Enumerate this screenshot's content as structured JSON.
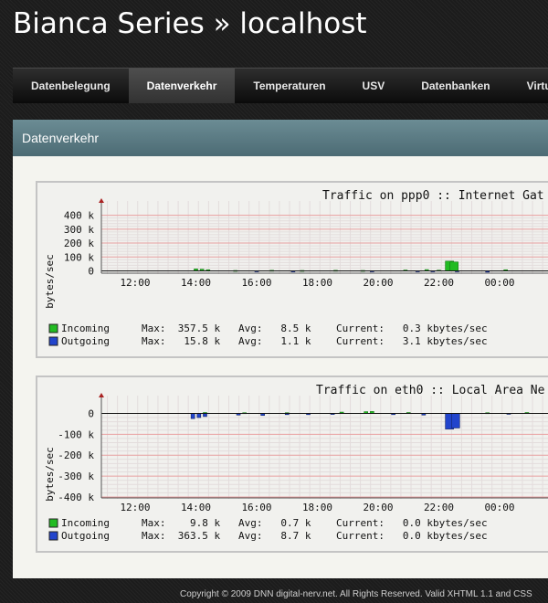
{
  "header": {
    "title": "Bianca Series » localhost"
  },
  "nav": [
    {
      "label": "Datenbelegung"
    },
    {
      "label": "Datenverkehr",
      "active": true
    },
    {
      "label": "Temperaturen"
    },
    {
      "label": "USV"
    },
    {
      "label": "Datenbanken"
    },
    {
      "label": "Virtua"
    }
  ],
  "panel": {
    "title": "Datenverkehr"
  },
  "graphs": [
    {
      "title": "Traffic on ppp0 :: Internet Gat",
      "ylabel": "bytes/sec",
      "legend": [
        {
          "label": "Incoming",
          "max": "Max:  357.5 k",
          "avg": "Avg:   8.5 k",
          "current": "Current:   0.3 kbytes/sec",
          "color": "#22bb22"
        },
        {
          "label": "Outgoing",
          "max": "Max:   15.8 k",
          "avg": "Avg:   1.1 k",
          "current": "Current:   3.1 kbytes/sec",
          "color": "#2244cc"
        }
      ]
    },
    {
      "title": "Traffic on eth0 :: Local Area Ne",
      "ylabel": "bytes/sec",
      "legend": [
        {
          "label": "Incoming",
          "max": "Max:    9.8 k",
          "avg": "Avg:   0.7 k",
          "current": "Current:   0.0 kbytes/sec",
          "color": "#22bb22"
        },
        {
          "label": "Outgoing",
          "max": "Max:  363.5 k",
          "avg": "Avg:   8.7 k",
          "current": "Current:   0.0 kbytes/sec",
          "color": "#2244cc"
        }
      ]
    }
  ],
  "chart_data": [
    {
      "type": "area",
      "title": "Traffic on ppp0 :: Internet Gat",
      "ylabel": "bytes/sec",
      "ylim": [
        -10,
        450
      ],
      "yticks": [
        0,
        100,
        200,
        300,
        400
      ],
      "ytick_labels": [
        "0",
        "100 k",
        "200 k",
        "300 k",
        "400 k"
      ],
      "xticks": [
        "12:00",
        "14:00",
        "16:00",
        "18:00",
        "20:00",
        "22:00",
        "00:00"
      ],
      "grid": true,
      "series": [
        {
          "name": "Incoming",
          "color": "#22bb22",
          "points": [
            [
              14.0,
              14
            ],
            [
              14.2,
              12
            ],
            [
              14.4,
              8
            ],
            [
              15.3,
              3
            ],
            [
              16.5,
              4
            ],
            [
              17.5,
              3
            ],
            [
              18.6,
              4
            ],
            [
              19.5,
              3
            ],
            [
              20.9,
              6
            ],
            [
              21.6,
              9
            ],
            [
              22.0,
              5
            ],
            [
              22.35,
              70
            ],
            [
              22.5,
              64
            ],
            [
              24.2,
              8
            ]
          ]
        },
        {
          "name": "Outgoing",
          "color": "#2244cc",
          "points": [
            [
              16.0,
              -3
            ],
            [
              17.2,
              -7
            ],
            [
              19.8,
              -3
            ],
            [
              21.3,
              -3
            ],
            [
              21.8,
              -4
            ],
            [
              22.6,
              -5
            ],
            [
              23.6,
              -9
            ]
          ]
        }
      ]
    },
    {
      "type": "area",
      "title": "Traffic on eth0 :: Local Area Ne",
      "ylabel": "bytes/sec",
      "ylim": [
        -400,
        50
      ],
      "yticks": [
        0,
        -100,
        -200,
        -300,
        -400
      ],
      "ytick_labels": [
        "0",
        "-100 k",
        "-200 k",
        "-300 k",
        "-400 k"
      ],
      "xticks": [
        "12:00",
        "14:00",
        "16:00",
        "18:00",
        "20:00",
        "22:00",
        "00:00"
      ],
      "grid": true,
      "series": [
        {
          "name": "Incoming",
          "color": "#22bb22",
          "points": [
            [
              14.3,
              4
            ],
            [
              15.6,
              3
            ],
            [
              17.0,
              3
            ],
            [
              18.8,
              6
            ],
            [
              19.6,
              8
            ],
            [
              19.8,
              9
            ],
            [
              21.0,
              4
            ],
            [
              23.6,
              3
            ],
            [
              24.9,
              4
            ]
          ]
        },
        {
          "name": "Outgoing",
          "color": "#2244cc",
          "points": [
            [
              13.9,
              -25
            ],
            [
              14.1,
              -20
            ],
            [
              14.3,
              -15
            ],
            [
              15.4,
              -8
            ],
            [
              16.2,
              -10
            ],
            [
              17.0,
              -6
            ],
            [
              17.7,
              -6
            ],
            [
              18.5,
              -5
            ],
            [
              20.5,
              -6
            ],
            [
              21.5,
              -8
            ],
            [
              22.35,
              -75
            ],
            [
              22.55,
              -70
            ],
            [
              24.3,
              -4
            ]
          ]
        }
      ]
    }
  ]
}
